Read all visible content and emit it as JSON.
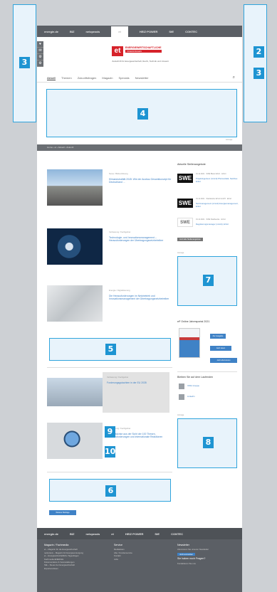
{
  "slots": {
    "s2": "2",
    "s3_left": "3",
    "s3_right": "3",
    "s4": "4",
    "s5": "5",
    "s6": "6",
    "s7": "7",
    "s8": "8",
    "s9": "9",
    "s10": "10"
  },
  "topbar": {
    "items": [
      "energie.de",
      "BIZ",
      "netzpraxis",
      "et",
      "HEIZ·POWER",
      "StE",
      "CONTEC"
    ]
  },
  "sidetools": [
    "♥",
    "✉",
    "⚙",
    "⚙"
  ],
  "logo": {
    "mark": "et",
    "line1": "ENERGIEWIRTSCHAFTLICHE",
    "line2": "TAGESFRAGEN"
  },
  "tagline": "Zeitschrift für Energiewirtschaft, Recht, Technik und Umwelt",
  "nav": {
    "items": [
      "Aktuell",
      "Themen",
      "Zukunftsfragen",
      "Magazin",
      "Specials",
      "Newsletter"
    ],
    "search_icon": "⌕"
  },
  "anzeige": "Anzeige",
  "breadcrumb": "Home › et › Aktuell › Zukunft",
  "teasers": [
    {
      "cat": "News / Bildverlinkung",
      "title": "Klimaneutralität 2045: Wie der Ausbau Gesamtkonzept für Deutschland ...",
      "img": "road-image"
    },
    {
      "cat": "Verfassung / Fachgebiet",
      "title": "Technologie- und Innovationsmanagement – Herausforderungen der Übertragungsnetzbetreiber",
      "img": "gears-image"
    },
    {
      "cat": "Energie / Digitalisierung",
      "title": "Die Herausforderungen im Netzbetrieb und Innovationsmanagement der Übertragungsnetzbetreiber",
      "img": "pylons-image"
    },
    {
      "cat": "Verfassung / Fachgebiet",
      "title": "Forderungsgutachten in der EU 2035",
      "img": "grid-image"
    },
    {
      "cat": "Verfassung / Fachgebiet",
      "title": "EU-Gaskrise aus der Sicht der 100 Thesen, Herausforderungen und internationale Reaktionen",
      "img": "globe-image"
    }
  ],
  "events_header": "Aktuelle Stellenangebote",
  "events": [
    {
      "logo": "SWE",
      "meta": "01.11.2021 · SWE Bietet Erfurt · Erfurt",
      "title": "Projektingenieur (m/w/d) Photovoltaik, Netzbau Erfurt"
    },
    {
      "logo": "SWE",
      "meta": "01.11.2021 · Stadtwerke Erfurt GmbH · Erfurt",
      "title": "Netzmanagement (m/w/d) Energiemanagement, Erfurt"
    },
    {
      "logo": "SWE",
      "meta": "01.11.2021 · SWE Stadtwerke · Erfurt",
      "title": "Regulierungsmanager (m/w/d), Erfurt"
    }
  ],
  "all_jobs_button": "Jetzt alle Stellenangebote",
  "magazine": {
    "header": "et² Online Jahresportal 2021",
    "buttons": [
      "Zur Ausgabe",
      "Jetzt lesen",
      "Jetzt abonnieren"
    ]
  },
  "social": {
    "header": "Bleiben Sie auf dem Laufenden",
    "items": [
      "XING Gruppe",
      "LinkedIn"
    ]
  },
  "more_button": "Weitere Beiträge",
  "footer": {
    "bar": [
      "energie.de",
      "BIZ",
      "netzpraxis",
      "et",
      "HEIZ·POWER",
      "StE",
      "CONTEC"
    ],
    "col1_head": "Magazin / Fachmedia",
    "col1": [
      "et – Magazin für die Energiewirtschaft",
      "netzpraxis – Magazin für Energieversorgung",
      "et – Energiewirtschaftliche Tagesfragen",
      "Fachmedia ENERGIE",
      "Dokumentation & Veranstaltungen",
      "StE – Steuer der Energiewirtschaft",
      "Expertenwissen"
    ],
    "col2_head": "Service",
    "col2": [
      "Mediadaten",
      "Abo / Kundenservice",
      "Kontakt",
      "Jobs"
    ],
    "col3_head": "Newsletter",
    "col3_text": "Abonnieren Sie unseren Newsletter",
    "col3_btn": "Jetzt anmelden",
    "col3_sub": "Sie haben noch Fragen?",
    "col3_link": "Kontaktieren Sie uns"
  }
}
